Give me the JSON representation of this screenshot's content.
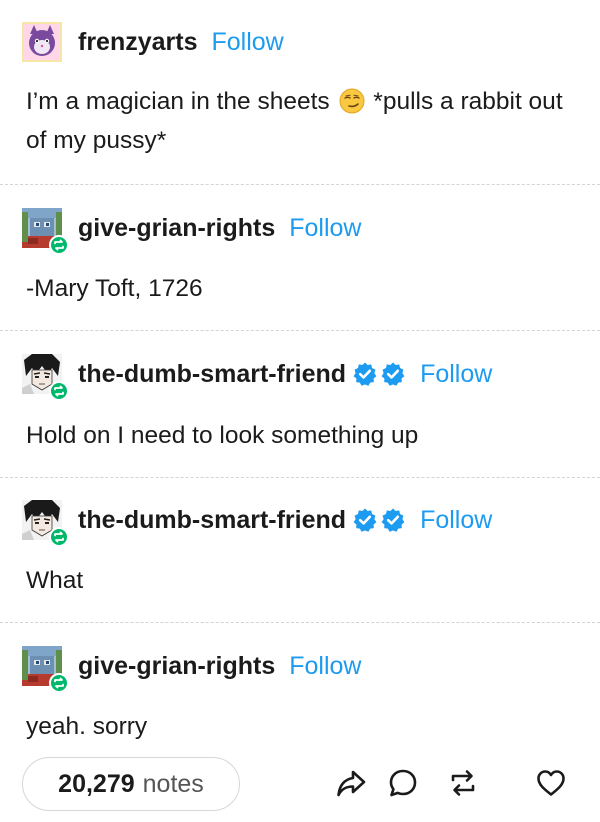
{
  "follow_label": "Follow",
  "posts": [
    {
      "username": "frenzyarts",
      "follow": "Follow",
      "text_before_emoji": "I’m a magician in the sheets ",
      "emoji_icon": "smirking-face-emoji",
      "text_after_emoji": " *pulls a rabbit out of my pussy*"
    },
    {
      "username": "give-grian-rights",
      "follow": "Follow",
      "text": "-Mary Toft, 1726"
    },
    {
      "username": "the-dumb-smart-friend",
      "follow": "Follow",
      "verified_badges": 2,
      "text": "Hold on I need to look something up"
    },
    {
      "username": "the-dumb-smart-friend",
      "follow": "Follow",
      "verified_badges": 2,
      "text": "What"
    },
    {
      "username": "give-grian-rights",
      "follow": "Follow",
      "text": "yeah. sorry"
    }
  ],
  "footer": {
    "notes_count": "20,279",
    "notes_label": "notes",
    "actions": [
      "share-icon",
      "reply-icon",
      "reblog-icon",
      "like-icon"
    ]
  },
  "colors": {
    "follow": "#1d9bf0",
    "verified": "#1d9bf0",
    "reblog_badge": "#00b86b",
    "text": "#1b1b1b"
  }
}
